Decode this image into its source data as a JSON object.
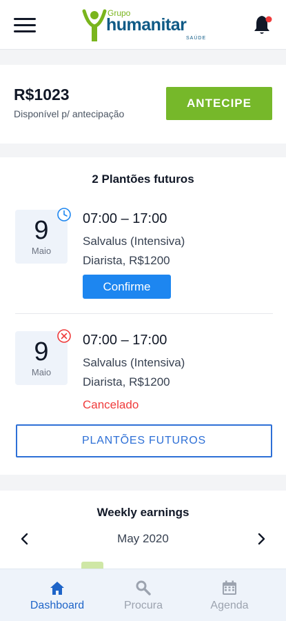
{
  "header": {
    "menu_icon": "hamburger-menu-icon",
    "logo": {
      "line1": "Grupo",
      "line2": "humanitar",
      "line3": "SAÚDE"
    },
    "bell_icon": "notification-bell-icon",
    "accent": "#7ab51d",
    "brand": "#0f5a86"
  },
  "balance": {
    "amount": "R$1023",
    "label": "Disponível p/ antecipação",
    "button_label": "ANTECIPE",
    "button_color": "#76b82a"
  },
  "shifts": {
    "title": "2 Plantões futuros",
    "items": [
      {
        "day": "9",
        "month": "Maio",
        "status_icon": "clock-icon",
        "time": "07:00 – 17:00",
        "place": "Salvalus (Intensiva)",
        "pay": "Diarista, R$1200",
        "action_label": "Confirme"
      },
      {
        "day": "9",
        "month": "Maio",
        "status_icon": "cancel-circle-icon",
        "time": "07:00 – 17:00",
        "place": "Salvalus (Intensiva)",
        "pay": "Diarista, R$1200",
        "status_text": "Cancelado"
      }
    ],
    "view_all_label": "PLANTÕES FUTUROS"
  },
  "earnings": {
    "title": "Weekly earnings",
    "period": "May 2020",
    "prev_icon": "chevron-left-icon",
    "next_icon": "chevron-right-icon"
  },
  "bottom_nav": [
    {
      "label": "Dashboard",
      "icon": "home-icon",
      "active": true
    },
    {
      "label": "Procura",
      "icon": "search-icon",
      "active": false
    },
    {
      "label": "Agenda",
      "icon": "calendar-icon",
      "active": false
    }
  ],
  "colors": {
    "primary_blue": "#1d86f0",
    "nav_active": "#1e64c8",
    "danger": "#ef3b3b"
  }
}
